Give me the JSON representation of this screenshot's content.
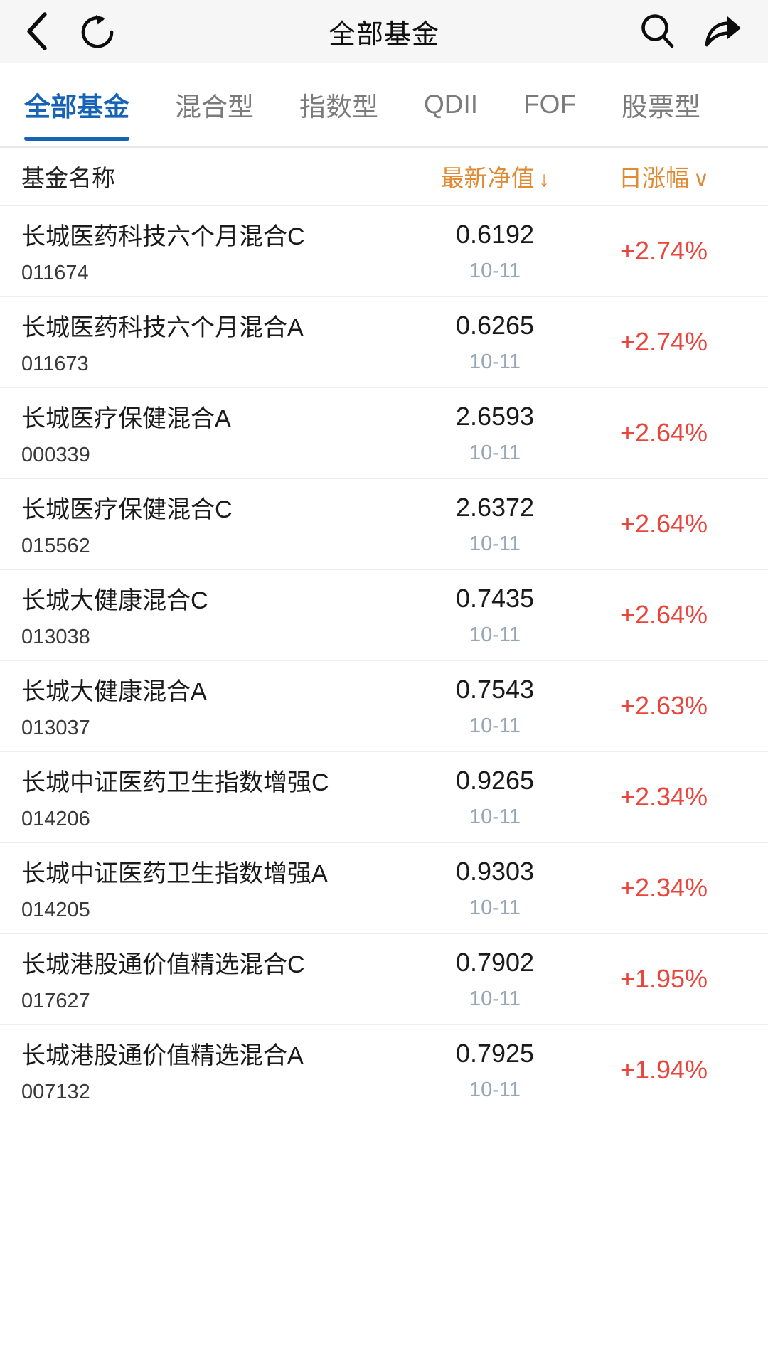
{
  "navbar": {
    "title": "全部基金",
    "back_icon": "chevron-left-icon",
    "refresh_icon": "refresh-icon",
    "search_icon": "search-icon",
    "share_icon": "share-icon"
  },
  "tabs": [
    {
      "label": "全部基金",
      "active": true
    },
    {
      "label": "混合型",
      "active": false
    },
    {
      "label": "指数型",
      "active": false
    },
    {
      "label": "QDII",
      "active": false
    },
    {
      "label": "FOF",
      "active": false
    },
    {
      "label": "股票型",
      "active": false
    }
  ],
  "columns": {
    "name": "基金名称",
    "nav": "最新净值",
    "nav_sort": "↓",
    "change": "日涨幅",
    "change_sort": "∨"
  },
  "colors": {
    "accent_blue": "#1763b6",
    "accent_orange": "#e08a33",
    "up_red": "#e8453c",
    "date_gray": "#96a6b4",
    "navbar_bg": "#f6f6f6"
  },
  "funds": [
    {
      "name": "长城医药科技六个月混合C",
      "code": "011674",
      "nav": "0.6192",
      "date": "10-11",
      "change": "+2.74%"
    },
    {
      "name": "长城医药科技六个月混合A",
      "code": "011673",
      "nav": "0.6265",
      "date": "10-11",
      "change": "+2.74%"
    },
    {
      "name": "长城医疗保健混合A",
      "code": "000339",
      "nav": "2.6593",
      "date": "10-11",
      "change": "+2.64%"
    },
    {
      "name": "长城医疗保健混合C",
      "code": "015562",
      "nav": "2.6372",
      "date": "10-11",
      "change": "+2.64%"
    },
    {
      "name": "长城大健康混合C",
      "code": "013038",
      "nav": "0.7435",
      "date": "10-11",
      "change": "+2.64%"
    },
    {
      "name": "长城大健康混合A",
      "code": "013037",
      "nav": "0.7543",
      "date": "10-11",
      "change": "+2.63%"
    },
    {
      "name": "长城中证医药卫生指数增强C",
      "code": "014206",
      "nav": "0.9265",
      "date": "10-11",
      "change": "+2.34%"
    },
    {
      "name": "长城中证医药卫生指数增强A",
      "code": "014205",
      "nav": "0.9303",
      "date": "10-11",
      "change": "+2.34%"
    },
    {
      "name": "长城港股通价值精选混合C",
      "code": "017627",
      "nav": "0.7902",
      "date": "10-11",
      "change": "+1.95%"
    },
    {
      "name": "长城港股通价值精选混合A",
      "code": "007132",
      "nav": "0.7925",
      "date": "10-11",
      "change": "+1.94%"
    }
  ]
}
